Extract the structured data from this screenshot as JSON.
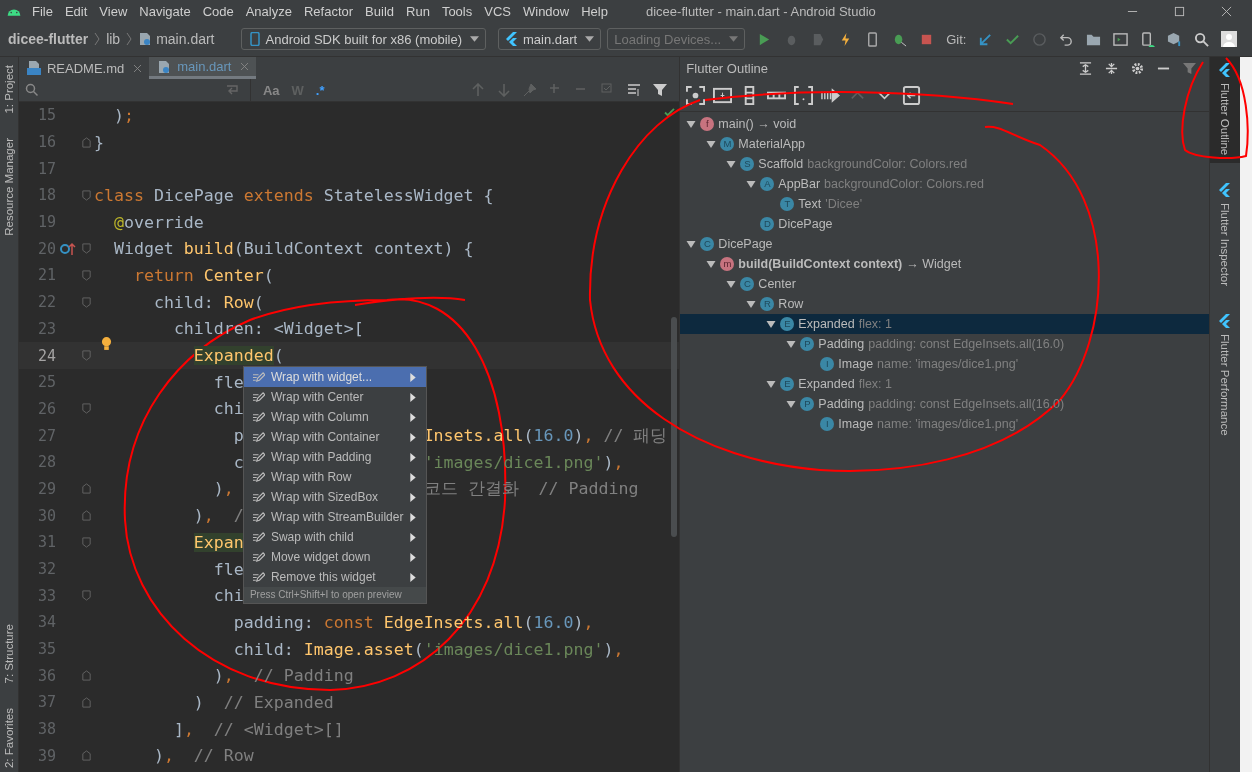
{
  "window": {
    "title": "dicee-flutter - main.dart - Android Studio"
  },
  "menu_bar": [
    "File",
    "Edit",
    "View",
    "Navigate",
    "Code",
    "Analyze",
    "Refactor",
    "Build",
    "Run",
    "Tools",
    "VCS",
    "Window",
    "Help"
  ],
  "breadcrumbs": [
    "dicee-flutter",
    "lib",
    "main.dart"
  ],
  "device_selector": {
    "value": "Android SDK built for x86 (mobile)"
  },
  "run_config": {
    "value": "main.dart"
  },
  "device_status": {
    "value": "Loading Devices..."
  },
  "git_label": "Git:",
  "left_tool_strip": {
    "top": [
      "1: Project",
      "Resource Manager"
    ],
    "bottom": [
      "7: Structure",
      "2: Favorites"
    ]
  },
  "editor_tabs": [
    {
      "label": "README.md",
      "kind": "markdown",
      "selected": false
    },
    {
      "label": "main.dart",
      "kind": "dart",
      "selected": true
    }
  ],
  "find_bar": {
    "match_case": "Aa",
    "words": "W",
    "regex": ".*"
  },
  "code_lines": [
    {
      "number": "15",
      "current": false,
      "fold_open": false,
      "fold_close": false,
      "override_marker": false,
      "bulb": false,
      "tokens": [
        {
          "text": "  )",
          "kind": "plain"
        },
        {
          "text": ";",
          "kind": "punct"
        }
      ]
    },
    {
      "number": "16",
      "current": false,
      "fold_open": false,
      "fold_close": true,
      "override_marker": false,
      "bulb": false,
      "tokens": [
        {
          "text": "}",
          "kind": "plain"
        }
      ]
    },
    {
      "number": "17",
      "current": false,
      "fold_open": false,
      "fold_close": false,
      "override_marker": false,
      "bulb": false
    },
    {
      "number": "18",
      "current": false,
      "fold_open": true,
      "fold_close": false,
      "override_marker": false,
      "bulb": false,
      "tokens": [
        {
          "text": "class",
          "kind": "keyword"
        },
        {
          "text": " DicePage",
          "kind": "plain"
        },
        {
          "text": " extends",
          "kind": "keyword"
        },
        {
          "text": " StatelessWidget {",
          "kind": "plain"
        }
      ]
    },
    {
      "number": "19",
      "current": false,
      "fold_open": false,
      "fold_close": false,
      "override_marker": false,
      "bulb": false,
      "tokens": [
        {
          "text": "  @",
          "kind": "annotation"
        },
        {
          "text": "override",
          "kind": "plain"
        }
      ]
    },
    {
      "number": "20",
      "current": false,
      "fold_open": true,
      "fold_close": false,
      "override_marker": true,
      "bulb": false,
      "tokens": [
        {
          "text": "  Widget",
          "kind": "plain"
        },
        {
          "text": " build",
          "kind": "type"
        },
        {
          "text": "(BuildContext context) {",
          "kind": "plain"
        }
      ]
    },
    {
      "number": "21",
      "current": false,
      "fold_open": true,
      "fold_close": false,
      "override_marker": false,
      "bulb": false,
      "tokens": [
        {
          "text": "    return",
          "kind": "keyword"
        },
        {
          "text": " Center",
          "kind": "type"
        },
        {
          "text": "(",
          "kind": "plain"
        }
      ]
    },
    {
      "number": "22",
      "current": false,
      "fold_open": true,
      "fold_close": false,
      "override_marker": false,
      "bulb": false,
      "tokens": [
        {
          "text": "      child:",
          "kind": "plain"
        },
        {
          "text": " Row",
          "kind": "type"
        },
        {
          "text": "(",
          "kind": "plain"
        }
      ]
    },
    {
      "number": "23",
      "current": false,
      "fold_open": false,
      "fold_close": false,
      "override_marker": false,
      "bulb": false,
      "tokens": [
        {
          "text": "        children: <Widget>[",
          "kind": "plain"
        }
      ]
    },
    {
      "number": "24",
      "current": true,
      "fold_open": true,
      "fold_close": false,
      "override_marker": false,
      "bulb": true,
      "tokens": [
        {
          "text": "          Expanded",
          "kind": "match"
        },
        {
          "text": "(",
          "kind": "plain"
        }
      ]
    },
    {
      "number": "25",
      "current": false,
      "fold_open": false,
      "fold_close": false,
      "override_marker": false,
      "bulb": false,
      "tokens": [
        {
          "text": "            fle",
          "kind": "plain"
        }
      ]
    },
    {
      "number": "26",
      "current": false,
      "fold_open": true,
      "fold_close": false,
      "override_marker": false,
      "bulb": false,
      "tokens": [
        {
          "text": "            chi",
          "kind": "plain"
        }
      ]
    },
    {
      "number": "27",
      "current": false,
      "fold_open": false,
      "fold_close": false,
      "override_marker": false,
      "bulb": false,
      "tokens": [
        {
          "text": "              p",
          "kind": "plain"
        },
        {
          "text": "                  Insets.all",
          "kind": "type"
        },
        {
          "text": "(",
          "kind": "plain"
        },
        {
          "text": "16.0",
          "kind": "number"
        },
        {
          "text": ")",
          "kind": "plain"
        },
        {
          "text": ",",
          "kind": "punct"
        },
        {
          "text": " // 패딩",
          "kind": "comment"
        }
      ]
    },
    {
      "number": "28",
      "current": false,
      "fold_open": false,
      "fold_close": false,
      "override_marker": false,
      "bulb": false,
      "tokens": [
        {
          "text": "              c",
          "kind": "plain"
        },
        {
          "text": "                  'images/dice1.png'",
          "kind": "string"
        },
        {
          "text": ")",
          "kind": "plain"
        },
        {
          "text": ",",
          "kind": "punct"
        }
      ]
    },
    {
      "number": "29",
      "current": false,
      "fold_open": false,
      "fold_close": true,
      "override_marker": false,
      "bulb": false,
      "tokens": [
        {
          "text": "            )",
          "kind": "plain"
        },
        {
          "text": ",",
          "kind": "punct"
        },
        {
          "text": "                   코드 간결화  // Padding",
          "kind": "comment"
        }
      ]
    },
    {
      "number": "30",
      "current": false,
      "fold_open": false,
      "fold_close": true,
      "override_marker": false,
      "bulb": false,
      "tokens": [
        {
          "text": "          )",
          "kind": "plain"
        },
        {
          "text": ",",
          "kind": "punct"
        },
        {
          "text": "  /",
          "kind": "comment"
        }
      ]
    },
    {
      "number": "31",
      "current": false,
      "fold_open": true,
      "fold_close": false,
      "override_marker": false,
      "bulb": false,
      "tokens": [
        {
          "text": "          Expan",
          "kind": "match"
        }
      ]
    },
    {
      "number": "32",
      "current": false,
      "fold_open": false,
      "fold_close": false,
      "override_marker": false,
      "bulb": false,
      "tokens": [
        {
          "text": "            fle",
          "kind": "plain"
        }
      ]
    },
    {
      "number": "33",
      "current": false,
      "fold_open": true,
      "fold_close": false,
      "override_marker": false,
      "bulb": false,
      "tokens": [
        {
          "text": "            chi",
          "kind": "plain"
        }
      ]
    },
    {
      "number": "34",
      "current": false,
      "fold_open": false,
      "fold_close": false,
      "override_marker": false,
      "bulb": false,
      "tokens": [
        {
          "text": "              padding:",
          "kind": "plain"
        },
        {
          "text": " const",
          "kind": "keyword"
        },
        {
          "text": " EdgeInsets.all",
          "kind": "type"
        },
        {
          "text": "(",
          "kind": "plain"
        },
        {
          "text": "16.0",
          "kind": "number"
        },
        {
          "text": ")",
          "kind": "plain"
        },
        {
          "text": ",",
          "kind": "punct"
        }
      ]
    },
    {
      "number": "35",
      "current": false,
      "fold_open": false,
      "fold_close": false,
      "override_marker": false,
      "bulb": false,
      "tokens": [
        {
          "text": "              child:",
          "kind": "plain"
        },
        {
          "text": " Image.asset",
          "kind": "type"
        },
        {
          "text": "(",
          "kind": "plain"
        },
        {
          "text": "'images/dice1.png'",
          "kind": "string"
        },
        {
          "text": ")",
          "kind": "plain"
        },
        {
          "text": ",",
          "kind": "punct"
        }
      ]
    },
    {
      "number": "36",
      "current": false,
      "fold_open": false,
      "fold_close": true,
      "override_marker": false,
      "bulb": false,
      "tokens": [
        {
          "text": "            )",
          "kind": "plain"
        },
        {
          "text": ",",
          "kind": "punct"
        },
        {
          "text": "  // Padding",
          "kind": "comment"
        }
      ]
    },
    {
      "number": "37",
      "current": false,
      "fold_open": false,
      "fold_close": true,
      "override_marker": false,
      "bulb": false,
      "tokens": [
        {
          "text": "          )",
          "kind": "plain"
        },
        {
          "text": "  // Expanded",
          "kind": "comment"
        }
      ]
    },
    {
      "number": "38",
      "current": false,
      "fold_open": false,
      "fold_close": false,
      "override_marker": false,
      "bulb": false,
      "tokens": [
        {
          "text": "        ]",
          "kind": "plain"
        },
        {
          "text": ",",
          "kind": "punct"
        },
        {
          "text": "  // <Widget>[]",
          "kind": "comment"
        }
      ]
    },
    {
      "number": "39",
      "current": false,
      "fold_open": false,
      "fold_close": true,
      "override_marker": false,
      "bulb": false,
      "tokens": [
        {
          "text": "      )",
          "kind": "plain"
        },
        {
          "text": ",",
          "kind": "punct"
        },
        {
          "text": "  // Row",
          "kind": "comment"
        }
      ]
    }
  ],
  "context_menu": {
    "items": [
      {
        "label": "Wrap with widget...",
        "selected": true
      },
      {
        "label": "Wrap with Center",
        "selected": false
      },
      {
        "label": "Wrap with Column",
        "selected": false
      },
      {
        "label": "Wrap with Container",
        "selected": false
      },
      {
        "label": "Wrap with Padding",
        "selected": false
      },
      {
        "label": "Wrap with Row",
        "selected": false
      },
      {
        "label": "Wrap with SizedBox",
        "selected": false
      },
      {
        "label": "Wrap with StreamBuilder",
        "selected": false
      },
      {
        "label": "Swap with child",
        "selected": false
      },
      {
        "label": "Move widget down",
        "selected": false
      },
      {
        "label": "Remove this widget",
        "selected": false
      }
    ],
    "hint": "Press Ctrl+Shift+I to open preview"
  },
  "outline_panel": {
    "title": "Flutter Outline",
    "tree": [
      {
        "badge": "f",
        "kind": "function",
        "name": "main() → void",
        "selected": false,
        "expanded": true,
        "children": [
          {
            "badge": "M",
            "kind": "widget",
            "name": "MaterialApp",
            "selected": false,
            "expanded": true,
            "children": [
              {
                "badge": "S",
                "kind": "widget",
                "name": "Scaffold",
                "detail": "backgroundColor: Colors.red",
                "selected": false,
                "expanded": true,
                "children": [
                  {
                    "badge": "A",
                    "kind": "widget",
                    "name": "AppBar",
                    "detail": "backgroundColor: Colors.red",
                    "selected": false,
                    "expanded": true,
                    "children": [
                      {
                        "badge": "T",
                        "kind": "widget",
                        "name": "Text",
                        "detail": "'Dicee'",
                        "selected": false
                      }
                    ]
                  },
                  {
                    "badge": "D",
                    "kind": "widget",
                    "name": "DicePage",
                    "selected": false
                  }
                ]
              }
            ]
          }
        ]
      },
      {
        "badge": "C",
        "kind": "widget",
        "name": "DicePage",
        "selected": false,
        "expanded": true,
        "children": [
          {
            "badge": "m",
            "kind": "method",
            "name": "build(BuildContext context)",
            "detail": "→ Widget",
            "selected": false,
            "expanded": true,
            "children": [
              {
                "badge": "C",
                "kind": "widget",
                "name": "Center",
                "selected": false,
                "expanded": true,
                "children": [
                  {
                    "badge": "R",
                    "kind": "widget",
                    "name": "Row",
                    "selected": false,
                    "expanded": true,
                    "children": [
                      {
                        "badge": "E",
                        "kind": "widget",
                        "name": "Expanded",
                        "detail": "flex: 1",
                        "selected": true,
                        "expanded": true,
                        "children": [
                          {
                            "badge": "P",
                            "kind": "widget",
                            "name": "Padding",
                            "detail": "padding: const EdgeInsets.all(16.0)",
                            "selected": false,
                            "expanded": true,
                            "children": [
                              {
                                "badge": "I",
                                "kind": "widget",
                                "name": "Image",
                                "detail": "name: 'images/dice1.png'",
                                "selected": false
                              }
                            ]
                          }
                        ]
                      },
                      {
                        "badge": "E",
                        "kind": "widget",
                        "name": "Expanded",
                        "detail": "flex: 1",
                        "selected": false,
                        "expanded": true,
                        "children": [
                          {
                            "badge": "P",
                            "kind": "widget",
                            "name": "Padding",
                            "detail": "padding: const EdgeInsets.all(16.0)",
                            "selected": false,
                            "expanded": true,
                            "children": [
                              {
                                "badge": "I",
                                "kind": "widget",
                                "name": "Image",
                                "detail": "name: 'images/dice1.png'",
                                "selected": false
                              }
                            ]
                          }
                        ]
                      }
                    ]
                  }
                ]
              }
            ]
          }
        ]
      }
    ]
  },
  "right_tool_strip": [
    {
      "label": "Flutter Outline",
      "selected": true
    },
    {
      "label": "Flutter Inspector",
      "selected": false
    },
    {
      "label": "Flutter Performance",
      "selected": false
    }
  ]
}
